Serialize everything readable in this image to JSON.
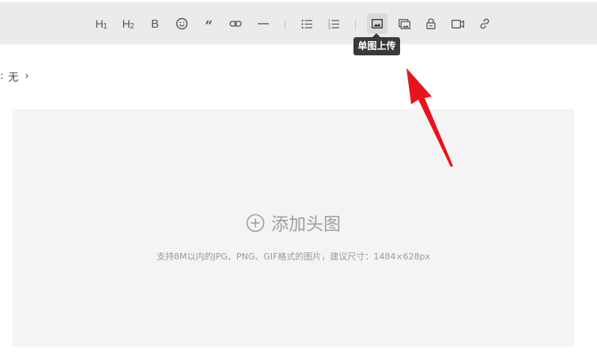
{
  "toolbar": {
    "buttons": [
      {
        "name": "heading1",
        "label": "H",
        "sub": "1"
      },
      {
        "name": "heading2",
        "label": "H",
        "sub": "2"
      },
      {
        "name": "bold",
        "label": "B"
      },
      {
        "name": "emoji",
        "icon": "smiley-icon"
      },
      {
        "name": "quote",
        "label": "“"
      },
      {
        "name": "link",
        "icon": "link-icon"
      },
      {
        "name": "divider",
        "icon": "horizontal-rule-icon"
      },
      {
        "name": "bullet-list",
        "icon": "bullet-list-icon"
      },
      {
        "name": "ordered-list",
        "icon": "ordered-list-icon"
      },
      {
        "name": "single-image",
        "icon": "image-icon",
        "active": true
      },
      {
        "name": "multi-image",
        "icon": "images-icon"
      },
      {
        "name": "lock",
        "icon": "lock-icon"
      },
      {
        "name": "video",
        "icon": "video-icon"
      },
      {
        "name": "insert-link",
        "icon": "chain-link-icon"
      }
    ],
    "tooltip": "单图上传"
  },
  "category": {
    "colon": ":",
    "value": "无",
    "chevron": "›"
  },
  "upload": {
    "title": "添加头图",
    "hint": "支持8M以内的JPG、PNG、GIF格式的图片，建议尺寸：1484×628px"
  },
  "colors": {
    "toolbar_bg": "#ebebeb",
    "upload_bg": "#f4f4f4",
    "tooltip_bg": "#3a3a3a",
    "arrow": "#e8141c"
  }
}
